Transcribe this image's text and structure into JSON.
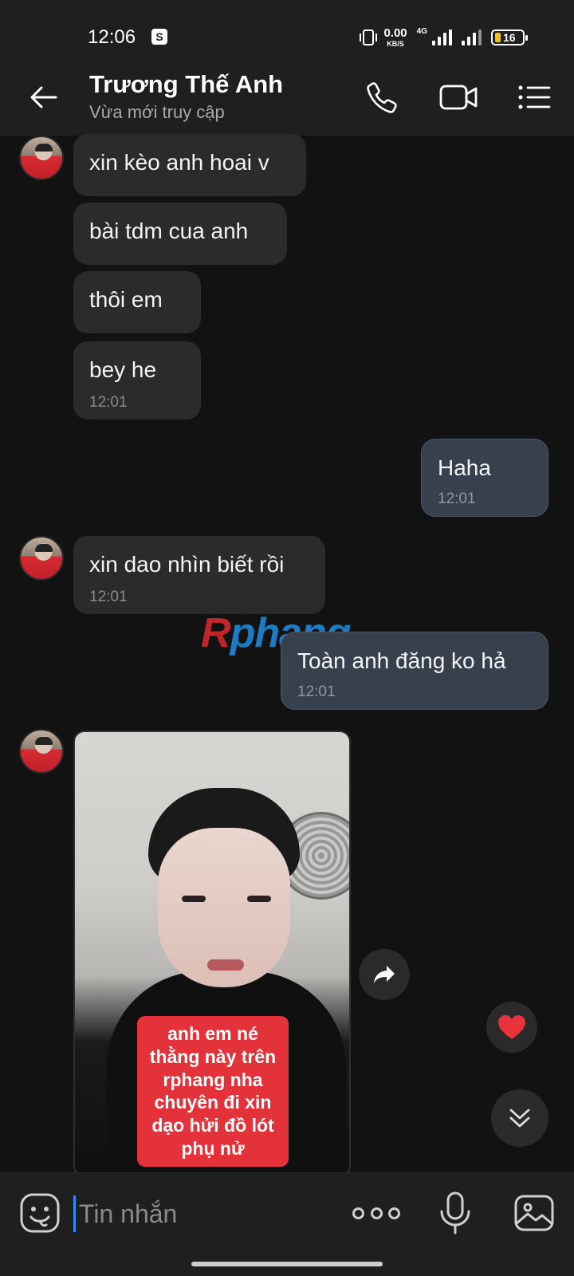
{
  "status_bar": {
    "time": "12:06",
    "shop_badge": "S",
    "net_speed_value": "0.00",
    "net_speed_unit": "KB/S",
    "network_type": "4G",
    "battery": "16"
  },
  "header": {
    "contact_name": "Trương Thế Anh",
    "contact_status": "Vừa mới truy cập"
  },
  "messages": [
    {
      "dir": "in",
      "text": "xin kèo anh hoai v"
    },
    {
      "dir": "in",
      "text": "bài tdm cua anh"
    },
    {
      "dir": "in",
      "text": "thôi em"
    },
    {
      "dir": "in",
      "text": "bey he",
      "time": "12:01"
    },
    {
      "dir": "out",
      "text": "Haha",
      "time": "12:01"
    },
    {
      "dir": "in",
      "text": "xin dao nhìn biết rồi",
      "time": "12:01"
    },
    {
      "dir": "out",
      "text": "Toàn anh đăng ko hả",
      "time": "12:01"
    }
  ],
  "photo_caption": "anh em né thằng này trên rphang nha chuyên đi xin dạo hửi đồ lót phụ nử",
  "watermark": {
    "r": "R",
    "rest": "phang"
  },
  "input": {
    "placeholder": "Tin nhắn"
  },
  "colors": {
    "incoming_bubble": "#2b2b2b",
    "outgoing_bubble": "#37414d",
    "accent": "#2f88ff",
    "heart": "#e8323c"
  }
}
